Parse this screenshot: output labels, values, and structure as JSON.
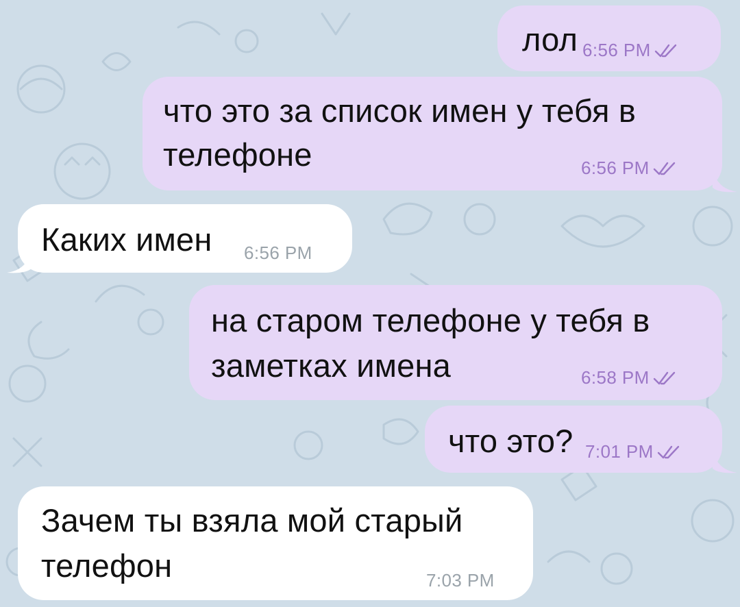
{
  "theme": {
    "outgoing_bubble": "#e6d7f7",
    "incoming_bubble": "#ffffff",
    "wallpaper": "#cfdde8",
    "outgoing_meta": "#9c77c7",
    "incoming_meta": "#9aa3aa"
  },
  "messages": [
    {
      "direction": "outgoing",
      "lines": [
        "лол"
      ],
      "time": "6:56 PM",
      "status_icon": "double-check-icon"
    },
    {
      "direction": "outgoing",
      "lines": [
        "что это за список имен у тебя в",
        "телефоне"
      ],
      "time": "6:56 PM",
      "status_icon": "double-check-icon"
    },
    {
      "direction": "incoming",
      "lines": [
        "Каких имен"
      ],
      "time": "6:56 PM"
    },
    {
      "direction": "outgoing",
      "lines": [
        "на старом телефоне у тебя в",
        "заметках имена"
      ],
      "time": "6:58 PM",
      "status_icon": "double-check-icon"
    },
    {
      "direction": "outgoing",
      "lines": [
        "что это?"
      ],
      "time": "7:01 PM",
      "status_icon": "double-check-icon"
    },
    {
      "direction": "incoming",
      "lines": [
        "Зачем ты взяла мой старый",
        "телефон"
      ],
      "time": "7:03 PM"
    }
  ]
}
